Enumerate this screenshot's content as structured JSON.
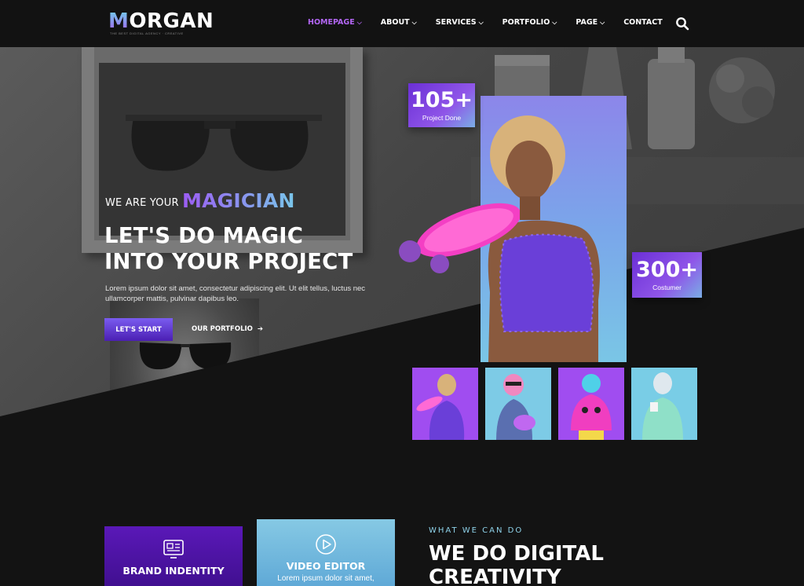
{
  "brand": {
    "logo_initial": "M",
    "logo_rest": "ORGAN",
    "tagline": "THE BEST DIGITAL AGENCY · CREATIVE",
    "accent": "#a55cf0",
    "accent2": "#79c6ea"
  },
  "nav": {
    "items": [
      {
        "label": "HOMEPAGE",
        "dropdown": true,
        "active": true
      },
      {
        "label": "ABOUT",
        "dropdown": true,
        "active": false
      },
      {
        "label": "SERVICES",
        "dropdown": true,
        "active": false
      },
      {
        "label": "PORTFOLIO",
        "dropdown": true,
        "active": false
      },
      {
        "label": "PAGE",
        "dropdown": true,
        "active": false
      },
      {
        "label": "CONTACT",
        "dropdown": false,
        "active": false
      }
    ],
    "search_icon": "search-icon"
  },
  "hero": {
    "pre": "WE ARE YOUR",
    "highlight": "MAGICIAN",
    "headline_line1": "LET'S DO MAGIC",
    "headline_line2": "INTO YOUR PROJECT",
    "description": "Lorem ipsum dolor sit amet, consectetur adipiscing elit. Ut elit tellus, luctus nec ullamcorper mattis, pulvinar dapibus leo.",
    "primary_button": "LET'S START",
    "secondary_button": "OUR PORTFOLIO",
    "secondary_icon": "arrow-right-icon"
  },
  "stats": [
    {
      "value": "105+",
      "label": "Project Done"
    },
    {
      "value": "300+",
      "label": "Costumer"
    }
  ],
  "services": {
    "eyebrow": "WHAT WE CAN DO",
    "title_line1": "WE DO DIGITAL",
    "title_line2": "CREATIVITY",
    "cards": [
      {
        "title": "BRAND INDENTITY",
        "icon": "brand-identity-icon",
        "desc": ""
      },
      {
        "title": "VIDEO EDITOR",
        "icon": "play-icon",
        "desc": "Lorem ipsum dolor sit amet,"
      }
    ]
  }
}
